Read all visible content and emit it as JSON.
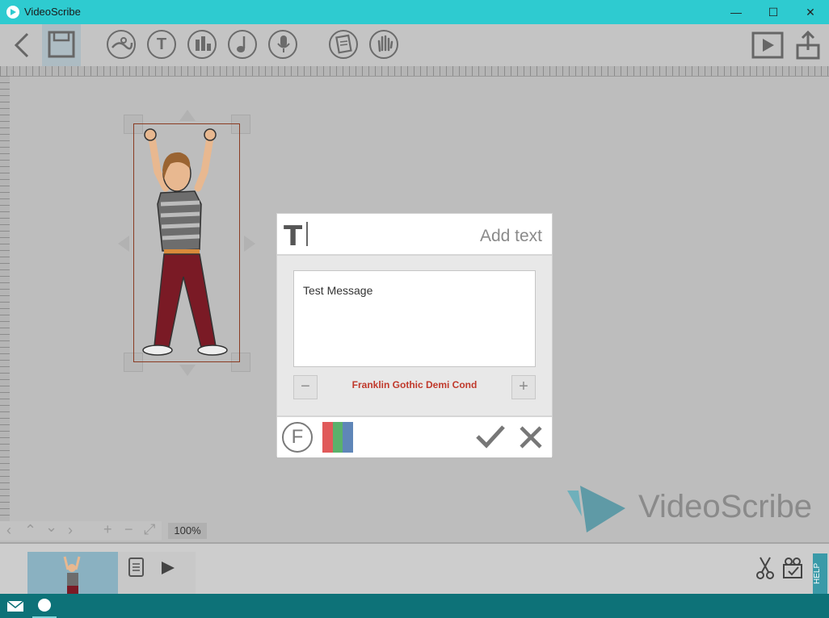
{
  "window": {
    "title": "VideoScribe",
    "minimize": "—",
    "maximize": "☐",
    "close": "✕"
  },
  "toolbar": {
    "icons": [
      "back-icon",
      "save-icon",
      "image-icon",
      "text-icon",
      "chart-icon",
      "music-icon",
      "voiceover-icon",
      "script-icon",
      "hand-icon",
      "play-icon",
      "publish-icon"
    ],
    "text_icon_glyph": "T"
  },
  "canvas": {
    "zoom": "100%",
    "watermark": "VideoScribe"
  },
  "dialog": {
    "header_icon": "T",
    "title": "Add text",
    "text_value": "Test Message",
    "font_name": "Franklin Gothic Demi Cond",
    "decrease_label": "−",
    "increase_label": "+",
    "font_button": "F",
    "swatch_colors": [
      "#e05a5a",
      "#5ab16b",
      "#5f86b8"
    ]
  },
  "colors": {
    "accent": "#2ecbd0",
    "taskbar": "#0d7278",
    "font_name": "#c0392b"
  },
  "timeline": {
    "side_label": "HELP"
  }
}
